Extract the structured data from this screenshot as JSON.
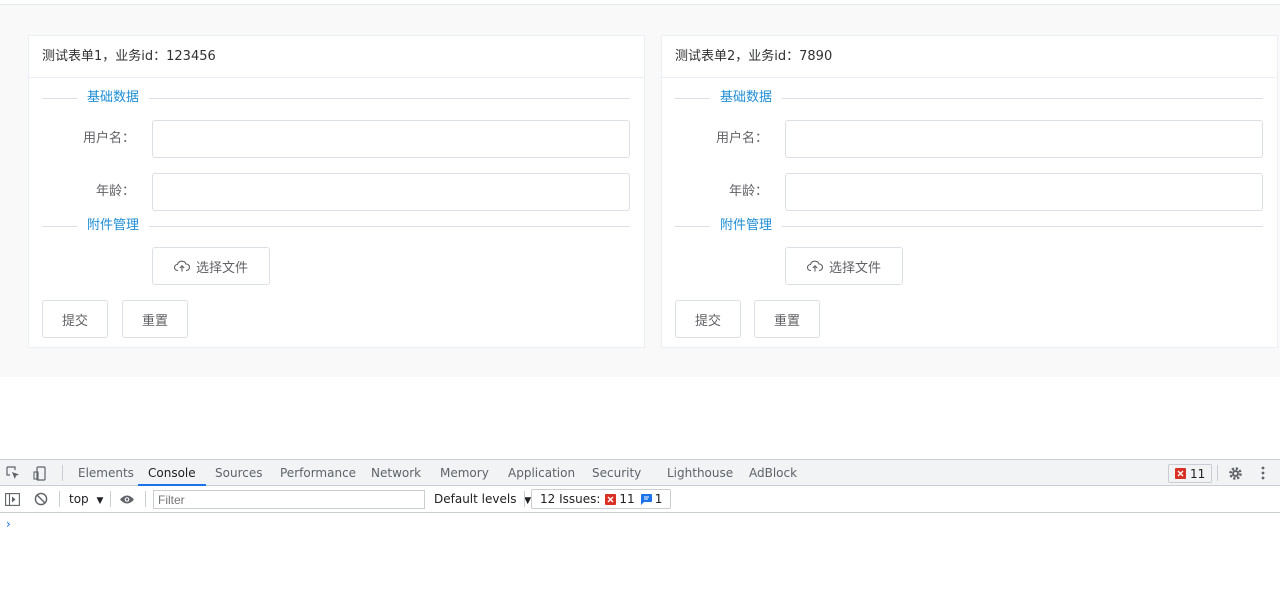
{
  "forms": [
    {
      "title": "测试表单1，业务id：123456",
      "section_basic": "基础数据",
      "username_label": "用户名：",
      "username_value": "",
      "age_label": "年龄：",
      "age_value": "",
      "section_attach": "附件管理",
      "choose_file_label": "选择文件",
      "submit_label": "提交",
      "reset_label": "重置"
    },
    {
      "title": "测试表单2，业务id：7890",
      "section_basic": "基础数据",
      "username_label": "用户名：",
      "username_value": "",
      "age_label": "年龄：",
      "age_value": "",
      "section_attach": "附件管理",
      "choose_file_label": "选择文件",
      "submit_label": "提交",
      "reset_label": "重置"
    }
  ],
  "devtools": {
    "tabs": [
      "Elements",
      "Console",
      "Sources",
      "Performance",
      "Network",
      "Memory",
      "Application",
      "Security",
      "Lighthouse",
      "AdBlock"
    ],
    "active_tab": "Console",
    "error_count": "11",
    "context": "top",
    "filter_placeholder": "Filter",
    "levels": "Default levels",
    "issues_label": "12 Issues:",
    "issues_errors": "11",
    "issues_info": "1",
    "prompt": "›"
  },
  "colors": {
    "accent": "#1e8ed6",
    "devtools_active": "#1a73e8",
    "error": "#d93025"
  }
}
